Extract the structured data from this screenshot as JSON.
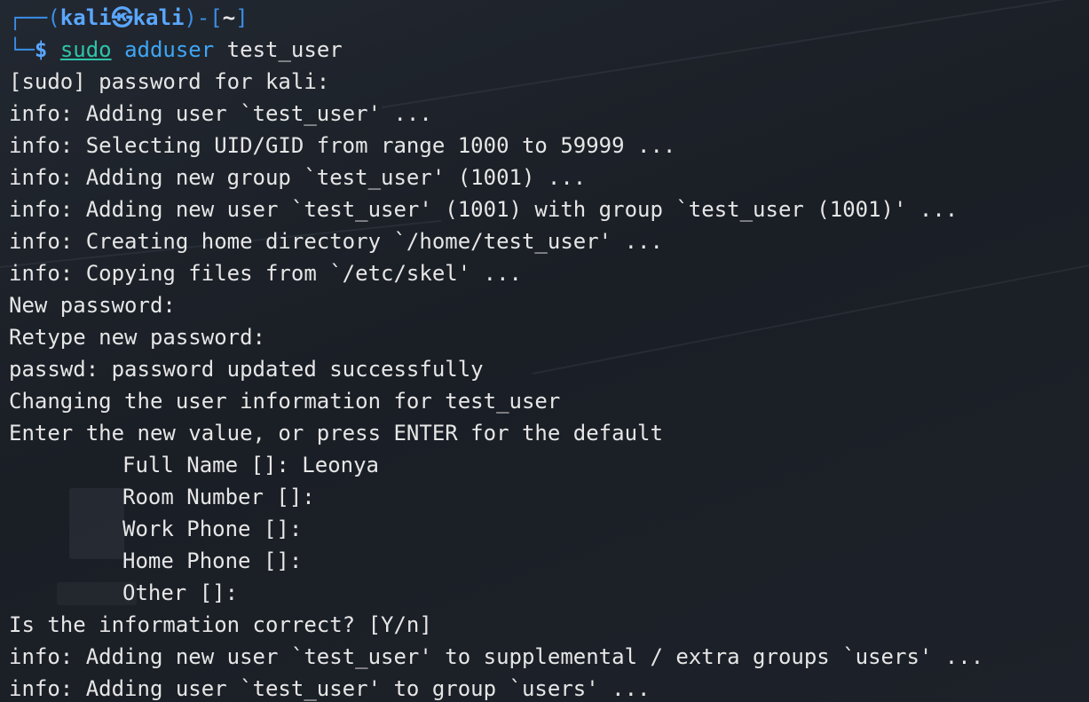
{
  "prompt": {
    "top_open": "┌──(",
    "user": "kali",
    "at_symbol": "㉿",
    "host": "kali",
    "mid": ")-[",
    "dir": "~",
    "top_close": "]",
    "bottom_corner": "└─",
    "dollar": "$ ",
    "command_sudo": "sudo",
    "command_main": "adduser",
    "command_arg": "test_user"
  },
  "output": [
    "[sudo] password for kali:",
    "info: Adding user `test_user' ...",
    "info: Selecting UID/GID from range 1000 to 59999 ...",
    "info: Adding new group `test_user' (1001) ...",
    "info: Adding new user `test_user' (1001) with group `test_user (1001)' ...",
    "info: Creating home directory `/home/test_user' ...",
    "info: Copying files from `/etc/skel' ...",
    "New password:",
    "Retype new password:",
    "passwd: password updated successfully",
    "Changing the user information for test_user",
    "Enter the new value, or press ENTER for the default"
  ],
  "user_info_fields": [
    "Full Name []: Leonya",
    "Room Number []:",
    "Work Phone []:",
    "Home Phone []:",
    "Other []:"
  ],
  "output_after": [
    "Is the information correct? [Y/n]",
    "info: Adding new user `test_user' to supplemental / extra groups `users' ...",
    "info: Adding user `test_user' to group `users' ..."
  ]
}
